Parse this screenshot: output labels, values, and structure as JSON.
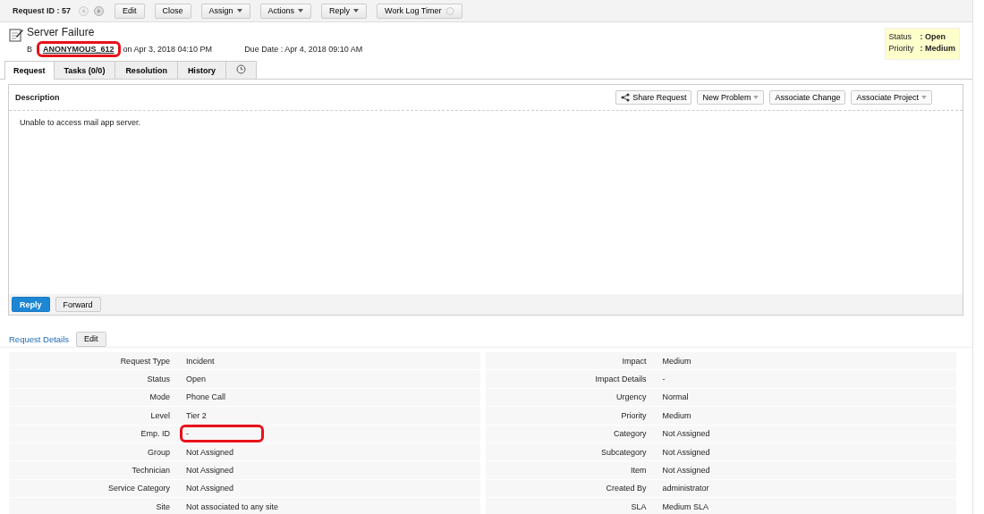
{
  "toolbar": {
    "request_id": "Request ID : 57",
    "buttons": [
      {
        "label": "Edit",
        "dropdown": false
      },
      {
        "label": "Close",
        "dropdown": false
      },
      {
        "label": "Assign",
        "dropdown": true
      },
      {
        "label": "Actions",
        "dropdown": true
      },
      {
        "label": "Reply",
        "dropdown": true
      }
    ],
    "timer": "Work Log Timer"
  },
  "header": {
    "title": "Server Failure",
    "by": "B",
    "author": "ANONYMOUS_612",
    "author_highlighted": true,
    "created": "on  Apr 3, 2018 04:10 PM",
    "due": "Due Date : Apr 4, 2018 09:10 AM"
  },
  "status_box": [
    {
      "label": "Status",
      "value": ": Open"
    },
    {
      "label": "Priority",
      "value": ": Medium"
    }
  ],
  "tabs": [
    {
      "label": "Request",
      "selected": true
    },
    {
      "label": "Tasks (0/0)",
      "selected": false
    },
    {
      "label": "Resolution",
      "selected": false
    },
    {
      "label": "History",
      "selected": false
    },
    {
      "kind": "clock",
      "selected": false
    }
  ],
  "description": {
    "title": "Description",
    "actions": [
      {
        "label": "Share Request",
        "kind": "share"
      },
      {
        "label": "New Problem",
        "kind": "dropdown"
      },
      {
        "label": "Associate Change",
        "kind": "plain"
      },
      {
        "label": "Associate Project",
        "kind": "dropdown"
      }
    ],
    "text": "Unable to access mail app server.",
    "buttons": [
      {
        "label": "Reply",
        "primary": true
      },
      {
        "label": "Forward",
        "primary": false
      }
    ]
  },
  "details": {
    "title": "Request Details",
    "edit": "Edit",
    "left": [
      {
        "label": "Request Type",
        "value": "Incident",
        "highlighted": false
      },
      {
        "label": "Status",
        "value": "Open",
        "highlighted": false
      },
      {
        "label": "Mode",
        "value": "Phone Call",
        "highlighted": false
      },
      {
        "label": "Level",
        "value": "Tier 2",
        "highlighted": false
      },
      {
        "label": "Emp. ID",
        "value": "-",
        "highlighted": true
      },
      {
        "label": "Group",
        "value": "Not Assigned",
        "highlighted": false
      },
      {
        "label": "Technician",
        "value": "Not Assigned",
        "highlighted": false
      },
      {
        "label": "Service Category",
        "value": "Not Assigned",
        "highlighted": false
      },
      {
        "label": "Site",
        "value": "Not associated to any site",
        "highlighted": false
      }
    ],
    "right": [
      {
        "label": "Impact",
        "value": "Medium",
        "highlighted": false
      },
      {
        "label": "Impact Details",
        "value": "-",
        "highlighted": false
      },
      {
        "label": "Urgency",
        "value": "Normal",
        "highlighted": false
      },
      {
        "label": "Priority",
        "value": "Medium",
        "highlighted": false
      },
      {
        "label": "Category",
        "value": "Not Assigned",
        "highlighted": false
      },
      {
        "label": "Subcategory",
        "value": "Not Assigned",
        "highlighted": false
      },
      {
        "label": "Item",
        "value": "Not Assigned",
        "highlighted": false
      },
      {
        "label": "Created By",
        "value": "administrator",
        "highlighted": false
      },
      {
        "label": "SLA",
        "value": "Medium SLA",
        "highlighted": false
      }
    ]
  }
}
